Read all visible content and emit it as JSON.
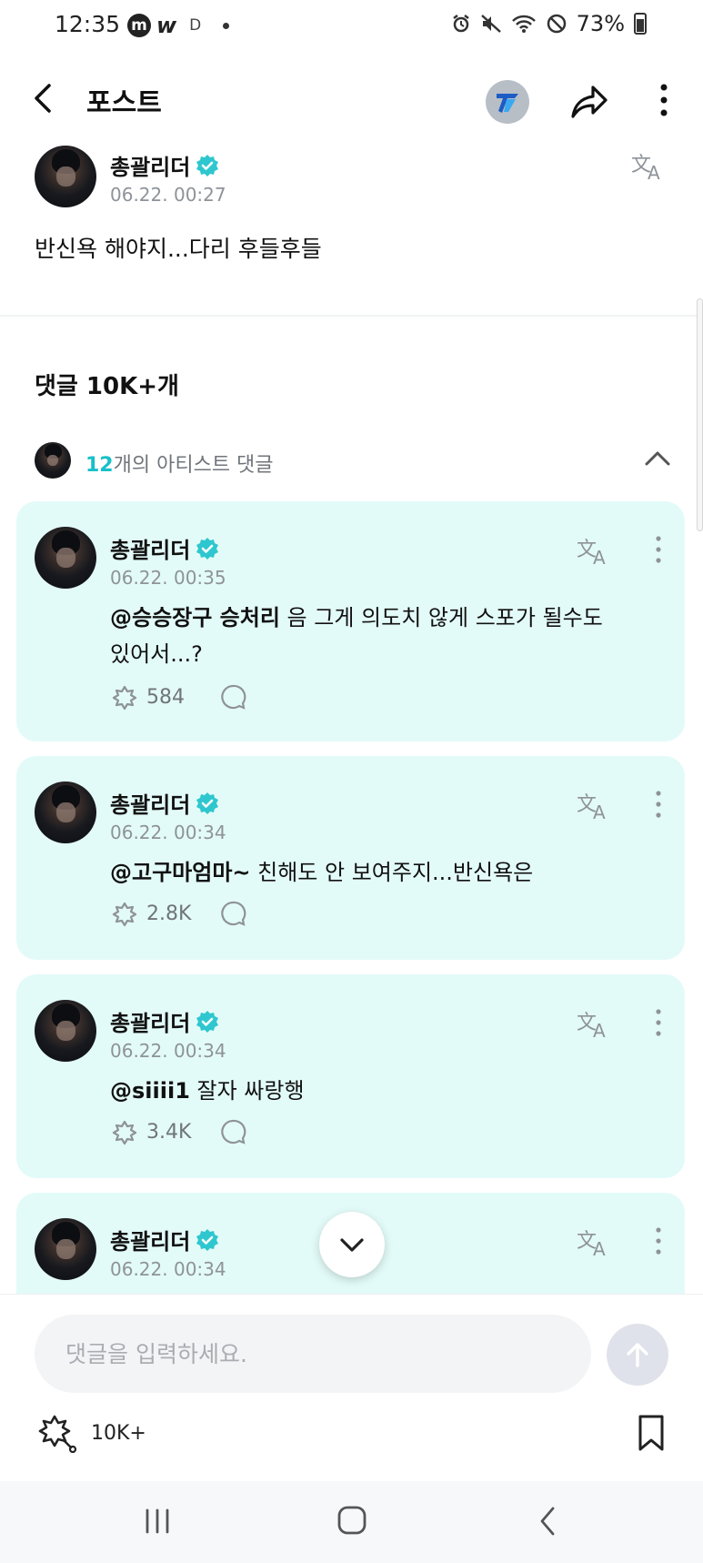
{
  "status_bar": {
    "time": "12:35",
    "app_m": "m",
    "app_w": "w",
    "app_d": "D",
    "battery": "73%"
  },
  "header": {
    "title": "포스트"
  },
  "post": {
    "author": "총괄리더",
    "date": "06.22. 00:27",
    "text": "반신욕 해야지...다리 후들후들"
  },
  "comments_title": "댓글 10K+개",
  "artist_comments": {
    "count": "12",
    "label": "개의 아티스트 댓글"
  },
  "comments": [
    {
      "author": "총괄리더",
      "date": "06.22. 00:35",
      "mention": "@승승장구 승처리",
      "text": " 음 그게 의도치 않게 스포가 될수도 있어서...?",
      "likes": "584"
    },
    {
      "author": "총괄리더",
      "date": "06.22. 00:34",
      "mention": "@고구마엄마~",
      "text": " 친해도 안 보여주지...반신욕은",
      "likes": "2.8K"
    },
    {
      "author": "총괄리더",
      "date": "06.22. 00:34",
      "mention": "@siiii1",
      "text": " 잘자 싸랑행",
      "likes": "3.4K"
    },
    {
      "author": "총괄리더",
      "date": "06.22. 00:34"
    }
  ],
  "composer": {
    "placeholder": "댓글을 입력하세요."
  },
  "reaction_count": "10K+",
  "colors": {
    "accent": "#17c0c8",
    "card_bg": "#e3fbf8",
    "verified": "#2fc7cf"
  }
}
